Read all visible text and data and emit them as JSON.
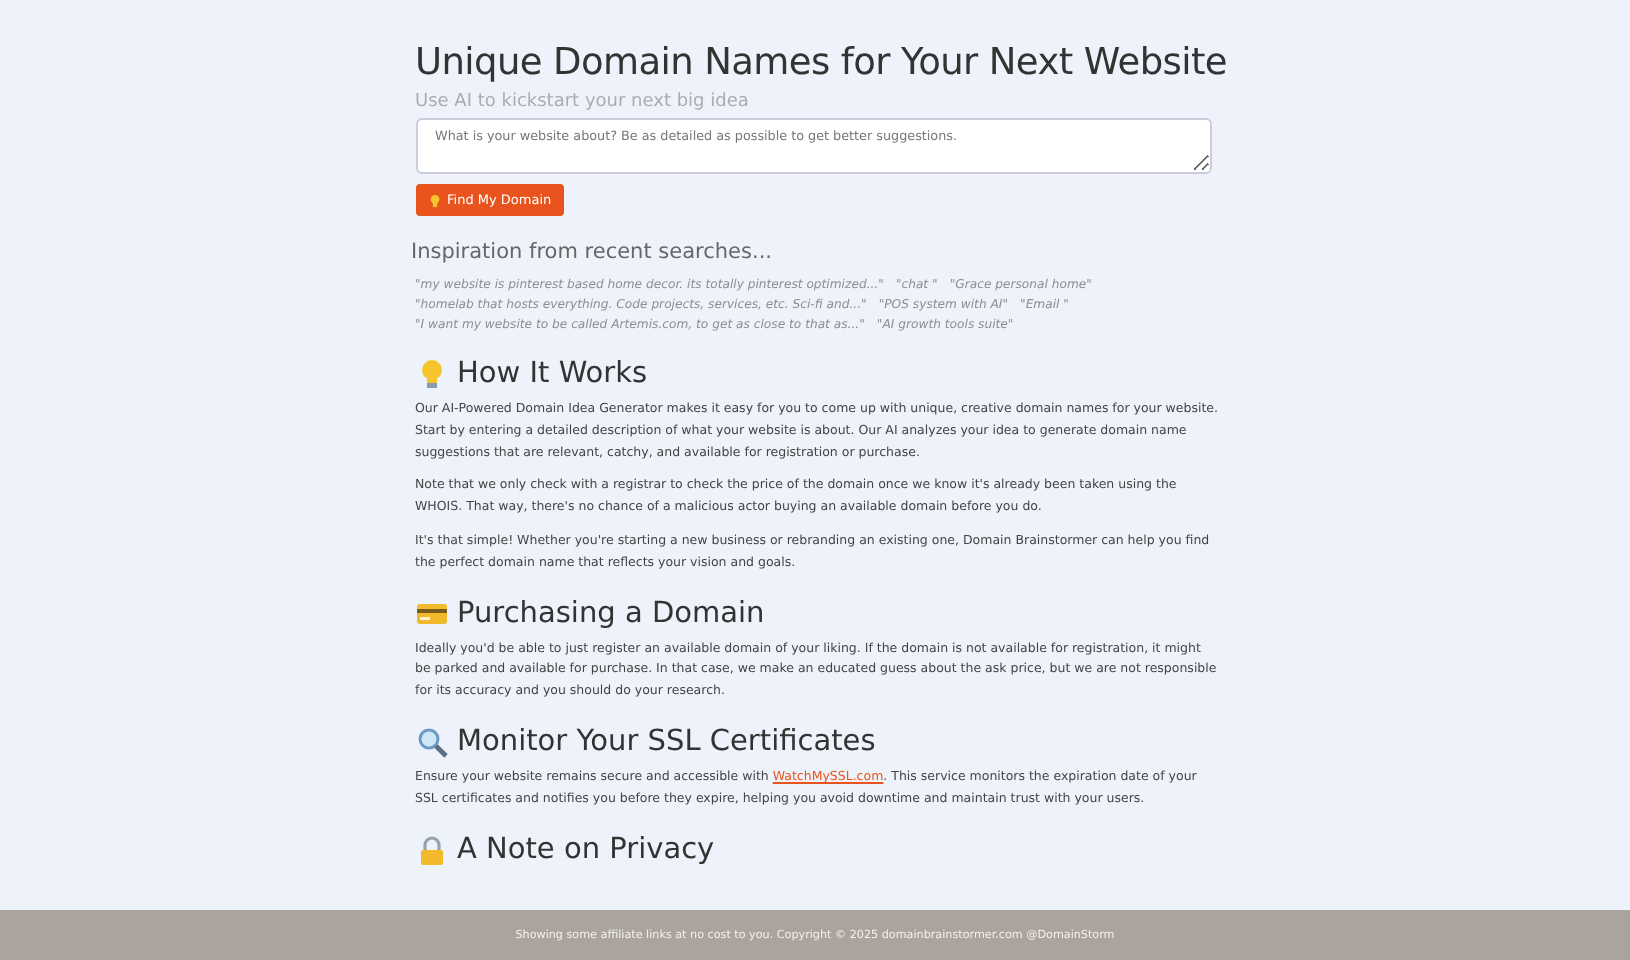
{
  "header": {
    "title": "Unique Domain Names for Your Next Website",
    "subtitle": "Use AI to kickstart your next big idea"
  },
  "search": {
    "placeholder": "What is your website about? Be as detailed as possible to get better suggestions.",
    "button": "Find My Domain"
  },
  "inspiration": {
    "heading": "Inspiration from recent searches...",
    "lines": [
      [
        "\"my website is pinterest based home decor. its totally pinterest optimized...\"",
        "\"chat \"",
        "\"Grace personal home\""
      ],
      [
        "\"homelab that hosts everything. Code projects, services, etc. Sci-fi and...\"",
        "\"POS system with AI\"",
        "\"Email \""
      ],
      [
        "\"I want my website to be called Artemis.com, to get as close to that as...\"",
        "\"AI growth tools suite\""
      ]
    ]
  },
  "sections": [
    {
      "heading": "How It Works",
      "paragraphs": [
        {
          "text": "Our AI-Powered Domain Idea Generator makes it easy for you to come up with unique, creative domain names for your website. Start by entering a detailed description of what your website is about. Our AI analyzes your idea to generate domain name suggestions that are relevant, catchy, and available for registration or purchase."
        },
        {
          "text": "Note that we only check with a registrar to check the price of the domain once we know it's already been taken using the WHOIS. That way, there's no chance of a malicious actor buying an available domain before you do."
        },
        {
          "text": "It's that simple! Whether you're starting a new business or rebranding an existing one, Domain Brainstormer can help you find the perfect domain name that reflects your vision and goals."
        }
      ]
    },
    {
      "heading": "Purchasing a Domain",
      "paragraphs": [
        {
          "text": "Ideally you'd be able to just register an available domain of your liking. If the domain is not available for registration, it might be parked and available for purchase. In that case, we make an educated guess about the ask price, but we are not responsible for its accuracy and you should do your research."
        }
      ]
    },
    {
      "heading": "Monitor Your SSL Certificates",
      "paragraphs": [
        {
          "text": "Ensure your website remains secure and accessible with ",
          "link": "WatchMySSL.com",
          "after": ". This service monitors the expiration date of your SSL certificates and notifies you before they expire, helping you avoid downtime and maintain trust with your users."
        }
      ]
    },
    {
      "heading": "A Note on Privacy"
    }
  ],
  "footer": "Showing some affiliate links at no cost to you. Copyright © 2025 domainbrainstormer.com @DomainStorm"
}
